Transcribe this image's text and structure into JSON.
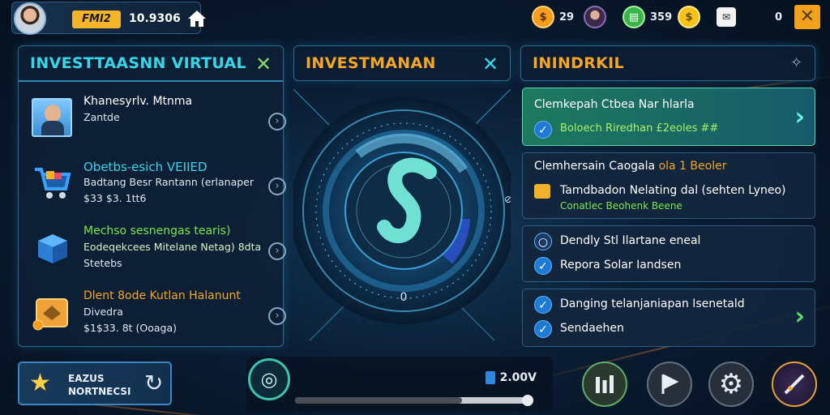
{
  "topbar": {
    "player_tag": "FMI2",
    "score": "10.9306",
    "resources": [
      {
        "icon": "coin-icon",
        "value": "29"
      },
      {
        "icon": "avatar-icon",
        "value": ""
      },
      {
        "icon": "ledger-icon",
        "value": "359"
      },
      {
        "icon": "gold-coin-icon",
        "value": ""
      },
      {
        "icon": "message-icon",
        "value": "0"
      }
    ],
    "close_label": "✕"
  },
  "left_panel": {
    "title": "INVESTTAASNN VIRTUAL",
    "items": [
      {
        "icon": "portrait-icon",
        "line1": "Khanesyrlv. Mtnma",
        "line2": "Zantde",
        "line3": ""
      },
      {
        "icon": "cart-icon",
        "line1": "Obetbs-esich VEIIED",
        "line2": "Badtang Besr Rantann (erlanaper",
        "line3": "$33 $3. 1tt6"
      },
      {
        "icon": "cube-icon",
        "line1": "Mechso sesnengas tearis)",
        "line2": "Eodeqekcees Mitelane Netag) 8dta",
        "line3": "Stetebs"
      },
      {
        "icon": "package-icon",
        "line1": "Dlent 8ode Kutlan Halanunt",
        "line2": "Divedra",
        "line3": "$1$33. 8t (Ooaga)"
      }
    ]
  },
  "center_panel": {
    "title": "INVESTMANAN"
  },
  "right_panel": {
    "title": "ININDRKIL",
    "cards": [
      {
        "title": "Clemkepah Ctbea Nar hlarla",
        "check": "Boloech Riredhan £2eoles ##"
      },
      {
        "title": "Clemhersain Caogala",
        "title_highlight": "ola 1 Beoler",
        "line1": "Tamdbadon Nelating dal (sehten Lyneo)",
        "line2": "Conatlec Beohenk Beene"
      },
      {
        "check1": "Dendly Stl Ilartane eneal",
        "check2": "Repora Solar Iandsen"
      },
      {
        "check1": "Danging telanjaniapan Isenetald",
        "check2": "Sendaehen"
      }
    ]
  },
  "bottom": {
    "promo_line1": "EAZUS",
    "promo_line2": "NORTNECSI",
    "meter_value": "2.00V",
    "progress": 0.7
  },
  "colors": {
    "cyan_title": "#36d7e8",
    "orange_title": "#f5a623",
    "green_text": "#7ee64b",
    "highlight_card": "#1f6b55"
  }
}
